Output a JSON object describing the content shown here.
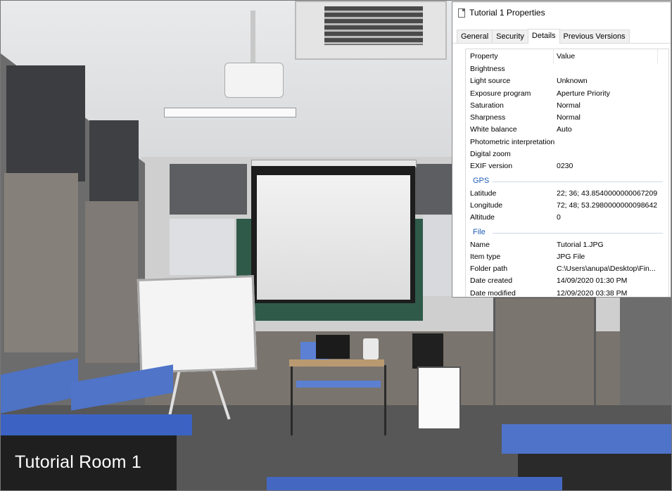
{
  "photo": {
    "caption": "Tutorial Room 1"
  },
  "dialog": {
    "title": "Tutorial 1 Properties",
    "title_icon": "file-icon",
    "tabs": [
      {
        "label": "General",
        "active": false
      },
      {
        "label": "Security",
        "active": false
      },
      {
        "label": "Details",
        "active": true
      },
      {
        "label": "Previous Versions",
        "active": false
      }
    ],
    "columns": {
      "property": "Property",
      "value": "Value"
    },
    "rows_top": [
      {
        "key": "Brightness",
        "value": ""
      },
      {
        "key": "Light source",
        "value": "Unknown"
      },
      {
        "key": "Exposure program",
        "value": "Aperture Priority"
      },
      {
        "key": "Saturation",
        "value": "Normal"
      },
      {
        "key": "Sharpness",
        "value": "Normal"
      },
      {
        "key": "White balance",
        "value": "Auto"
      },
      {
        "key": "Photometric interpretation",
        "value": ""
      },
      {
        "key": "Digital zoom",
        "value": ""
      },
      {
        "key": "EXIF version",
        "value": "0230"
      }
    ],
    "gps_label": "GPS",
    "rows_gps": [
      {
        "key": "Latitude",
        "value": "22; 36; 43.8540000000067209"
      },
      {
        "key": "Longitude",
        "value": "72; 48; 53.2980000000098642"
      },
      {
        "key": "Altitude",
        "value": "0"
      }
    ],
    "file_label": "File",
    "rows_file": [
      {
        "key": "Name",
        "value": "Tutorial 1.JPG"
      },
      {
        "key": "Item type",
        "value": "JPG File"
      },
      {
        "key": "Folder path",
        "value": "C:\\Users\\anupa\\Desktop\\Fin..."
      },
      {
        "key": "Date created",
        "value": "14/09/2020 01:30 PM"
      },
      {
        "key": "Date modified",
        "value": "12/09/2020 03:38 PM"
      }
    ]
  }
}
